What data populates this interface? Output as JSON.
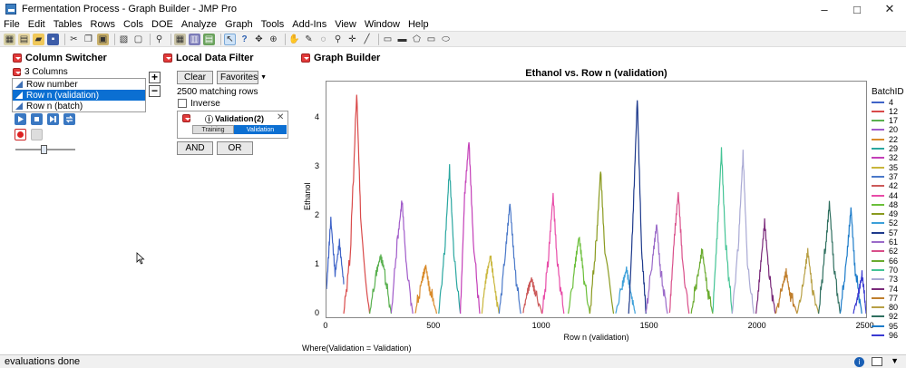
{
  "window": {
    "title": "Fermentation Process - Graph Builder - JMP Pro"
  },
  "menu": [
    "File",
    "Edit",
    "Tables",
    "Rows",
    "Cols",
    "DOE",
    "Analyze",
    "Graph",
    "Tools",
    "Add-Ins",
    "View",
    "Window",
    "Help"
  ],
  "column_switcher": {
    "title": "Column Switcher",
    "count_label": "3 Columns",
    "columns": [
      {
        "label": "Row number",
        "selected": false
      },
      {
        "label": "Row n (validation)",
        "selected": true
      },
      {
        "label": "Row n (batch)",
        "selected": false
      }
    ],
    "plus": "+",
    "minus": "−"
  },
  "local_data_filter": {
    "title": "Local Data Filter",
    "clear_label": "Clear",
    "favorites_label": "Favorites",
    "matching_rows": "2500 matching rows",
    "inverse_label": "Inverse",
    "filter_name": "Validation",
    "filter_count": "(2)",
    "seg_training": "Training",
    "seg_validation": "Validation",
    "and_label": "AND",
    "or_label": "OR"
  },
  "graph_builder": {
    "title": "Graph Builder"
  },
  "chart_data": {
    "type": "line",
    "title": "Ethanol vs. Row n (validation)",
    "xlabel": "Row n (validation)",
    "ylabel": "Ethanol",
    "xlim": [
      0,
      2500
    ],
    "ylim": [
      0,
      4.6
    ],
    "xticks": [
      0,
      500,
      1000,
      1500,
      2000,
      2500
    ],
    "yticks": [
      0,
      1,
      2,
      3,
      4
    ],
    "legend_title": "BatchID",
    "legend_placement": "right",
    "series": [
      {
        "name": "4",
        "color": "#3f64c8",
        "x": [
          0,
          20,
          40,
          60,
          80
        ],
        "values": [
          0.5,
          2.0,
          0.9,
          1.5,
          0.6
        ]
      },
      {
        "name": "12",
        "color": "#d94a4a",
        "x": [
          80,
          110,
          140,
          160,
          200
        ],
        "values": [
          0.0,
          1.2,
          4.5,
          1.8,
          0.0
        ]
      },
      {
        "name": "17",
        "color": "#59b04f",
        "x": [
          200,
          230,
          250,
          270,
          300
        ],
        "values": [
          0.0,
          0.8,
          1.1,
          0.8,
          0.0
        ]
      },
      {
        "name": "20",
        "color": "#a05ac9",
        "x": [
          300,
          330,
          350,
          370,
          400
        ],
        "values": [
          0.0,
          1.6,
          2.4,
          1.0,
          0.0
        ]
      },
      {
        "name": "22",
        "color": "#d98b2b",
        "x": [
          410,
          440,
          460,
          480,
          510
        ],
        "values": [
          0.0,
          0.6,
          1.0,
          0.5,
          0.0
        ]
      },
      {
        "name": "29",
        "color": "#2aa7a0",
        "x": [
          520,
          550,
          570,
          590,
          620
        ],
        "values": [
          0.0,
          1.4,
          2.9,
          1.2,
          0.0
        ]
      },
      {
        "name": "32",
        "color": "#c43fb8",
        "x": [
          620,
          640,
          660,
          680,
          710
        ],
        "values": [
          0.0,
          2.5,
          3.6,
          1.5,
          0.0
        ]
      },
      {
        "name": "35",
        "color": "#c9b63b",
        "x": [
          720,
          740,
          760,
          780,
          800
        ],
        "values": [
          0.0,
          0.7,
          1.2,
          0.6,
          0.0
        ]
      },
      {
        "name": "37",
        "color": "#4b79c9",
        "x": [
          800,
          830,
          850,
          870,
          900
        ],
        "values": [
          0.0,
          1.3,
          2.2,
          1.0,
          0.0
        ]
      },
      {
        "name": "42",
        "color": "#cc5a5a",
        "x": [
          910,
          930,
          950,
          970,
          1000
        ],
        "values": [
          0.0,
          0.5,
          0.8,
          0.4,
          0.0
        ]
      },
      {
        "name": "44",
        "color": "#e84ca8",
        "x": [
          1000,
          1030,
          1050,
          1070,
          1100
        ],
        "values": [
          0.0,
          1.2,
          2.4,
          1.0,
          0.0
        ]
      },
      {
        "name": "48",
        "color": "#6bbf3a",
        "x": [
          1120,
          1150,
          1170,
          1190,
          1220
        ],
        "values": [
          0.0,
          0.9,
          1.5,
          0.8,
          0.0
        ]
      },
      {
        "name": "49",
        "color": "#8a9a1f",
        "x": [
          1220,
          1250,
          1270,
          1290,
          1330
        ],
        "values": [
          0.0,
          1.5,
          3.0,
          1.2,
          0.0
        ]
      },
      {
        "name": "52",
        "color": "#3ca0d9",
        "x": [
          1340,
          1370,
          1390,
          1410,
          1430
        ],
        "values": [
          0.0,
          0.6,
          1.0,
          0.5,
          0.0
        ]
      },
      {
        "name": "57",
        "color": "#1e3a8c",
        "x": [
          1400,
          1420,
          1440,
          1460,
          1480
        ],
        "values": [
          0.0,
          2.0,
          4.4,
          1.2,
          0.0
        ]
      },
      {
        "name": "61",
        "color": "#9b6bc9",
        "x": [
          1480,
          1510,
          1530,
          1550,
          1580
        ],
        "values": [
          0.0,
          1.1,
          1.9,
          0.8,
          0.0
        ]
      },
      {
        "name": "62",
        "color": "#d94f8a",
        "x": [
          1590,
          1610,
          1630,
          1650,
          1680
        ],
        "values": [
          0.0,
          1.4,
          2.4,
          1.0,
          0.0
        ]
      },
      {
        "name": "66",
        "color": "#6aab2f",
        "x": [
          1690,
          1720,
          1740,
          1760,
          1790
        ],
        "values": [
          0.0,
          0.8,
          1.3,
          0.6,
          0.0
        ]
      },
      {
        "name": "70",
        "color": "#44c495",
        "x": [
          1790,
          1810,
          1830,
          1850,
          1880
        ],
        "values": [
          0.0,
          1.6,
          3.4,
          1.4,
          0.0
        ]
      },
      {
        "name": "73",
        "color": "#a9a9d4",
        "x": [
          1880,
          1910,
          1930,
          1950,
          1980
        ],
        "values": [
          0.0,
          1.5,
          3.2,
          1.0,
          0.0
        ]
      },
      {
        "name": "74",
        "color": "#7a2a7a",
        "x": [
          1990,
          2010,
          2030,
          2050,
          2080
        ],
        "values": [
          0.0,
          1.0,
          1.9,
          0.8,
          0.0
        ]
      },
      {
        "name": "77",
        "color": "#c07f2e",
        "x": [
          2080,
          2110,
          2130,
          2150,
          2180
        ],
        "values": [
          0.0,
          0.5,
          0.9,
          0.4,
          0.0
        ]
      },
      {
        "name": "80",
        "color": "#b8a045",
        "x": [
          2180,
          2210,
          2230,
          2250,
          2280
        ],
        "values": [
          0.0,
          0.6,
          1.2,
          0.5,
          0.0
        ]
      },
      {
        "name": "92",
        "color": "#2f6f5f",
        "x": [
          2280,
          2310,
          2330,
          2350,
          2380
        ],
        "values": [
          0.0,
          1.3,
          2.3,
          1.0,
          0.0
        ]
      },
      {
        "name": "95",
        "color": "#1b7bc9",
        "x": [
          2380,
          2410,
          2430,
          2450,
          2480
        ],
        "values": [
          0.0,
          1.1,
          2.2,
          0.9,
          0.0
        ]
      },
      {
        "name": "96",
        "color": "#3a3ad1",
        "x": [
          2440,
          2460,
          2480,
          2490,
          2500
        ],
        "values": [
          0.0,
          0.4,
          0.8,
          0.5,
          0.0
        ]
      }
    ]
  },
  "where_clause": "Where(Validation = Validation)",
  "status": "evaluations done"
}
